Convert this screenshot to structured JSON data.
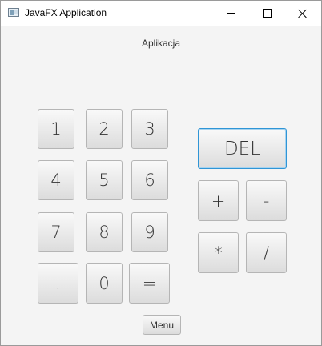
{
  "window": {
    "title": "JavaFX Application"
  },
  "header": {
    "label": "Aplikacja"
  },
  "keypad": {
    "k1": "1",
    "k2": "2",
    "k3": "3",
    "k4": "4",
    "k5": "5",
    "k6": "6",
    "k7": "7",
    "k8": "8",
    "k9": "9",
    "dot": ".",
    "k0": "0",
    "equals": "="
  },
  "operators": {
    "del": "DEL",
    "plus": "+",
    "minus": "-",
    "multiply": "*",
    "divide": "/"
  },
  "footer": {
    "menu": "Menu"
  },
  "icons": {
    "app": "java-app-icon",
    "minimize": "minimize-icon",
    "maximize": "maximize-icon",
    "close": "close-icon"
  },
  "colors": {
    "focus_border": "#2f95d6",
    "background": "#f4f4f4"
  }
}
